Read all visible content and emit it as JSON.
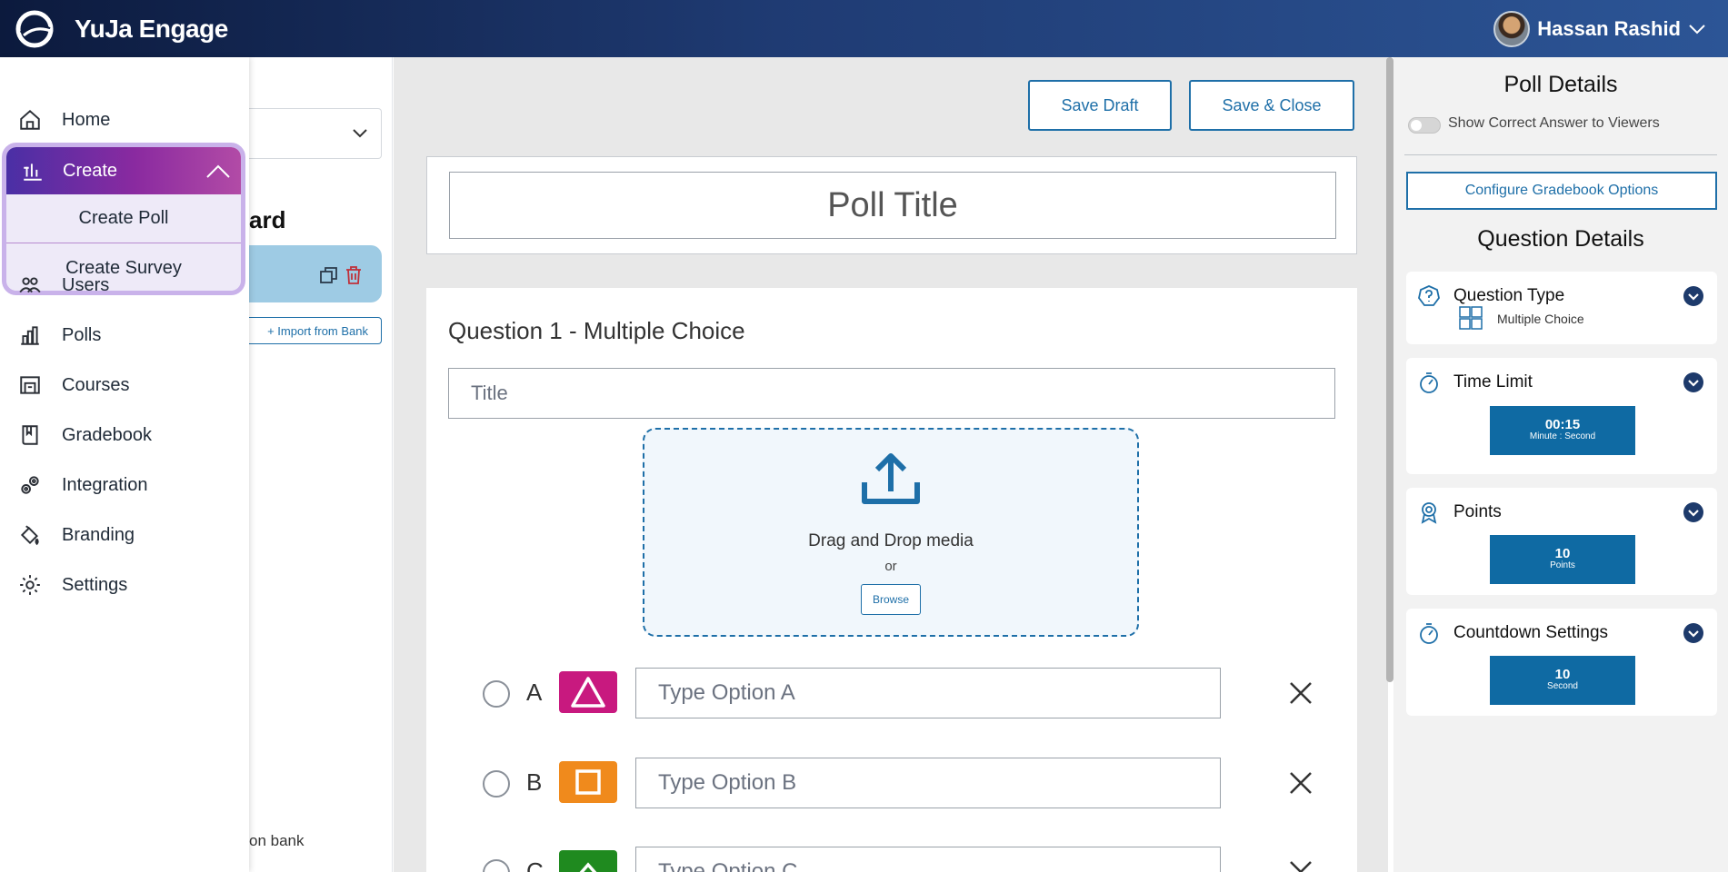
{
  "app": {
    "name": "YuJa Engage",
    "user_name": "Hassan Rashid"
  },
  "nav": {
    "home": "Home",
    "create": "Create",
    "create_poll": "Create Poll",
    "create_survey": "Create Survey",
    "users": "Users",
    "polls": "Polls",
    "courses": "Courses",
    "gradebook": "Gradebook",
    "integration": "Integration",
    "branding": "Branding",
    "settings": "Settings"
  },
  "question_panel": {
    "heading_partial": "ard",
    "import_label": "+ Import from Bank",
    "bank_partial": "on bank"
  },
  "toolbar": {
    "save_draft": "Save Draft",
    "save_close": "Save & Close"
  },
  "poll": {
    "title_placeholder": "Poll Title",
    "question_heading": "Question 1 - Multiple Choice",
    "question_title_placeholder": "Title",
    "media": {
      "drag_text": "Drag and Drop media",
      "or_text": "or",
      "browse_label": "Browse"
    },
    "options": [
      {
        "letter": "A",
        "placeholder": "Type Option A",
        "color": "#c8197f",
        "shape": "triangle-icon"
      },
      {
        "letter": "B",
        "placeholder": "Type Option B",
        "color": "#f08a1c",
        "shape": "square-icon"
      },
      {
        "letter": "C",
        "placeholder": "Type Option C",
        "color": "#1f8a1f",
        "shape": "chevron-up-icon"
      }
    ]
  },
  "details": {
    "poll_details_title": "Poll Details",
    "show_correct_label": "Show Correct Answer to Viewers",
    "gradebook_button": "Configure Gradebook Options",
    "question_details_title": "Question Details",
    "question_type": {
      "title": "Question Type",
      "value": "Multiple Choice"
    },
    "time_limit": {
      "title": "Time Limit",
      "value": "00:15",
      "unit": "Minute : Second"
    },
    "points": {
      "title": "Points",
      "value": "10",
      "unit": "Points"
    },
    "countdown": {
      "title": "Countdown Settings",
      "value": "10",
      "unit": "Second"
    }
  },
  "colors": {
    "accent": "#1e6fa8",
    "value_box": "#0f6aa3",
    "create_gradient_start": "#4a2fa5",
    "create_gradient_end": "#b24ba6"
  }
}
